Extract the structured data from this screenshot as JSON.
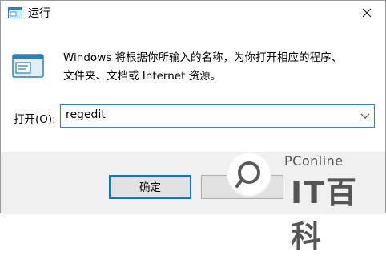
{
  "window": {
    "title": "运行"
  },
  "description": {
    "line1": "Windows 将根据你所输入的名称，为你打开相应的程序、",
    "line2": "文件夹、文档或 Internet 资源。"
  },
  "open_field": {
    "label": "打开(O):",
    "value": "regedit"
  },
  "buttons": {
    "ok": "确定",
    "cancel": ""
  },
  "watermark": {
    "small": "PConline",
    "big": "IT百科"
  },
  "colors": {
    "accent": "#0078d7",
    "footer": "#f0f0f0"
  }
}
